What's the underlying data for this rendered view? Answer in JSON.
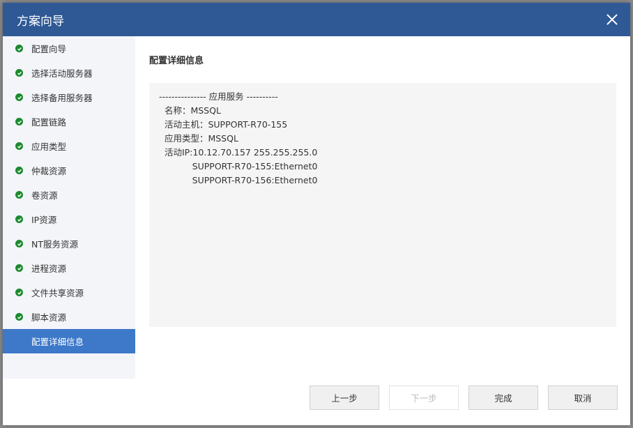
{
  "dialog": {
    "title": "方案向导",
    "close_icon": "close-icon"
  },
  "sidebar": {
    "items": [
      {
        "label": "配置向导",
        "done": true
      },
      {
        "label": "选择活动服务器",
        "done": true
      },
      {
        "label": "选择备用服务器",
        "done": true
      },
      {
        "label": "配置链路",
        "done": true
      },
      {
        "label": "应用类型",
        "done": true
      },
      {
        "label": "仲裁资源",
        "done": true
      },
      {
        "label": "卷资源",
        "done": true
      },
      {
        "label": "IP资源",
        "done": true
      },
      {
        "label": "NT服务资源",
        "done": true
      },
      {
        "label": "进程资源",
        "done": true
      },
      {
        "label": "文件共享资源",
        "done": true
      },
      {
        "label": "脚本资源",
        "done": true
      },
      {
        "label": "配置详细信息",
        "done": false,
        "active": true
      }
    ]
  },
  "main": {
    "section_title": "配置详细信息",
    "details": [
      "--------------- 应用服务 ----------",
      "  名称：MSSQL",
      "  活动主机：SUPPORT-R70-155",
      "  应用类型：MSSQL",
      "  活动IP:10.12.70.157 255.255.255.0",
      "            SUPPORT-R70-155:Ethernet0",
      "            SUPPORT-R70-156:Ethernet0"
    ]
  },
  "buttons": {
    "prev": "上一步",
    "next": "下一步",
    "finish": "完成",
    "cancel": "取消"
  },
  "colors": {
    "titlebar": "#2f5995",
    "active_step": "#3d78c9",
    "check": "#1c8a2e"
  }
}
